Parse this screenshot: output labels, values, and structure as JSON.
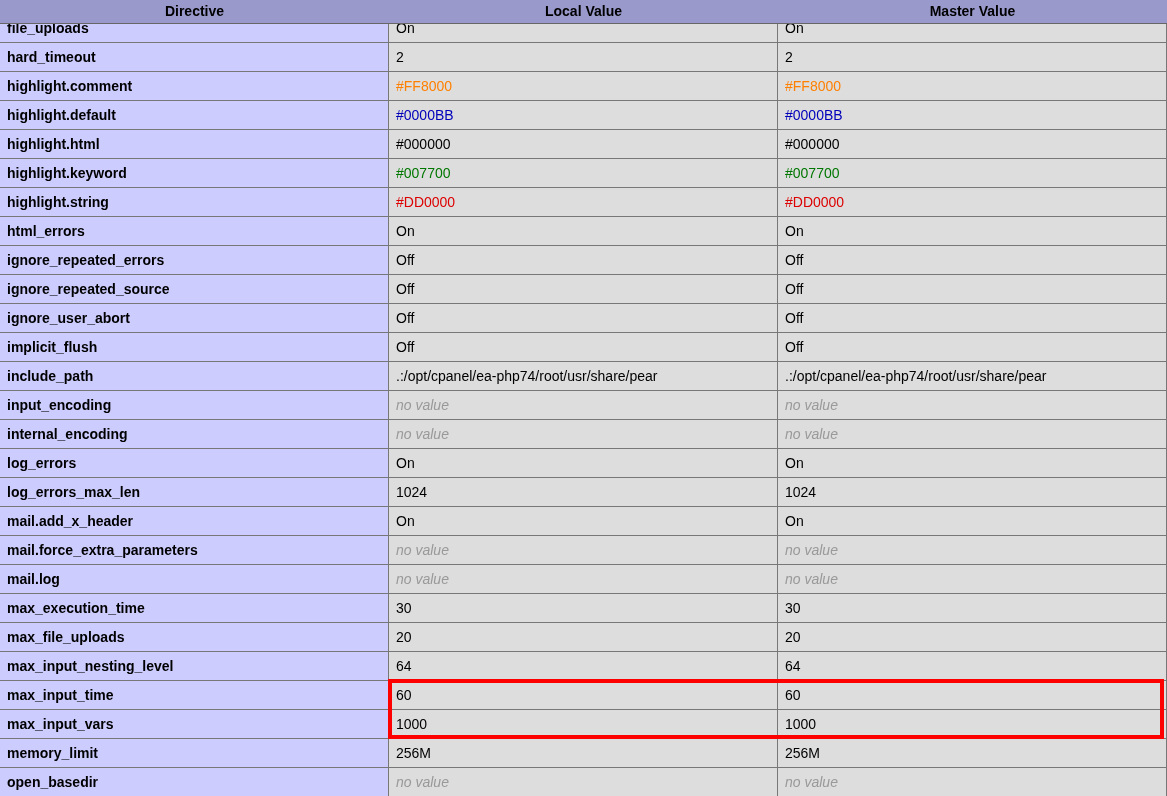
{
  "columns": [
    "Directive",
    "Local Value",
    "Master Value"
  ],
  "rows": [
    {
      "directive": "file_uploads",
      "local": "On",
      "master": "On",
      "kind": "text",
      "highlighted": false
    },
    {
      "directive": "hard_timeout",
      "local": "2",
      "master": "2",
      "kind": "text",
      "highlighted": false
    },
    {
      "directive": "highlight.comment",
      "local": "#FF8000",
      "master": "#FF8000",
      "kind": "colored",
      "color": "#ff8000",
      "highlighted": false
    },
    {
      "directive": "highlight.default",
      "local": "#0000BB",
      "master": "#0000BB",
      "kind": "colored",
      "color": "#0000bb",
      "highlighted": false
    },
    {
      "directive": "highlight.html",
      "local": "#000000",
      "master": "#000000",
      "kind": "colored",
      "color": "#000000",
      "highlighted": false
    },
    {
      "directive": "highlight.keyword",
      "local": "#007700",
      "master": "#007700",
      "kind": "colored",
      "color": "#007700",
      "highlighted": false
    },
    {
      "directive": "highlight.string",
      "local": "#DD0000",
      "master": "#DD0000",
      "kind": "colored",
      "color": "#dd0000",
      "highlighted": false
    },
    {
      "directive": "html_errors",
      "local": "On",
      "master": "On",
      "kind": "text",
      "highlighted": false
    },
    {
      "directive": "ignore_repeated_errors",
      "local": "Off",
      "master": "Off",
      "kind": "text",
      "highlighted": false
    },
    {
      "directive": "ignore_repeated_source",
      "local": "Off",
      "master": "Off",
      "kind": "text",
      "highlighted": false
    },
    {
      "directive": "ignore_user_abort",
      "local": "Off",
      "master": "Off",
      "kind": "text",
      "highlighted": false
    },
    {
      "directive": "implicit_flush",
      "local": "Off",
      "master": "Off",
      "kind": "text",
      "highlighted": false
    },
    {
      "directive": "include_path",
      "local": ".:/opt/cpanel/ea-php74/root/usr/share/pear",
      "master": ".:/opt/cpanel/ea-php74/root/usr/share/pear",
      "kind": "text",
      "highlighted": false
    },
    {
      "directive": "input_encoding",
      "local": "no value",
      "master": "no value",
      "kind": "empty",
      "highlighted": false
    },
    {
      "directive": "internal_encoding",
      "local": "no value",
      "master": "no value",
      "kind": "empty",
      "highlighted": false
    },
    {
      "directive": "log_errors",
      "local": "On",
      "master": "On",
      "kind": "text",
      "highlighted": false
    },
    {
      "directive": "log_errors_max_len",
      "local": "1024",
      "master": "1024",
      "kind": "text",
      "highlighted": false
    },
    {
      "directive": "mail.add_x_header",
      "local": "On",
      "master": "On",
      "kind": "text",
      "highlighted": false
    },
    {
      "directive": "mail.force_extra_parameters",
      "local": "no value",
      "master": "no value",
      "kind": "empty",
      "highlighted": false
    },
    {
      "directive": "mail.log",
      "local": "no value",
      "master": "no value",
      "kind": "empty",
      "highlighted": false
    },
    {
      "directive": "max_execution_time",
      "local": "30",
      "master": "30",
      "kind": "text",
      "highlighted": false
    },
    {
      "directive": "max_file_uploads",
      "local": "20",
      "master": "20",
      "kind": "text",
      "highlighted": false
    },
    {
      "directive": "max_input_nesting_level",
      "local": "64",
      "master": "64",
      "kind": "text",
      "highlighted": false
    },
    {
      "directive": "max_input_time",
      "local": "60",
      "master": "60",
      "kind": "text",
      "highlighted": true
    },
    {
      "directive": "max_input_vars",
      "local": "1000",
      "master": "1000",
      "kind": "text",
      "highlighted": true
    },
    {
      "directive": "memory_limit",
      "local": "256M",
      "master": "256M",
      "kind": "text",
      "highlighted": false
    },
    {
      "directive": "open_basedir",
      "local": "no value",
      "master": "no value",
      "kind": "empty",
      "highlighted": false
    }
  ]
}
